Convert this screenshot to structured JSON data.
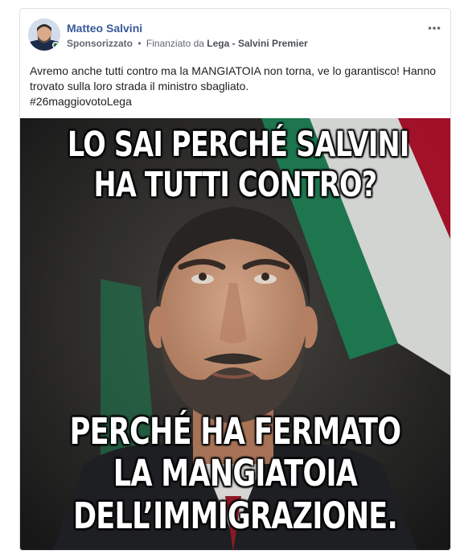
{
  "post": {
    "author": "Matteo Salvini",
    "sponsored": "Sponsorizzato",
    "separator": "•",
    "funded_by": "Finanziato da",
    "payer": "Lega - Salvini Premier",
    "more_icon": "more-horizontal-icon",
    "text_line1": "Avremo anche tutti contro ma la MANGIATOIA non torna, ve lo garantisco! Hanno",
    "text_line2": "trovato sulla loro strada il ministro sbagliato.",
    "hashtag": "#26maggiovotoLega"
  },
  "image": {
    "caption_top": [
      "LO SAI PERCHÉ SALVINI",
      "HA TUTTI CONTRO?"
    ],
    "caption_bottom": [
      "PERCHÉ HA FERMATO",
      "LA MANGIATOIA",
      "DELL’IMMIGRAZIONE."
    ]
  },
  "colors": {
    "author": "#385898",
    "meta": "#616770",
    "flag_green": "#1f8a5a",
    "flag_white": "#eef1ee",
    "flag_red": "#c8102e"
  }
}
